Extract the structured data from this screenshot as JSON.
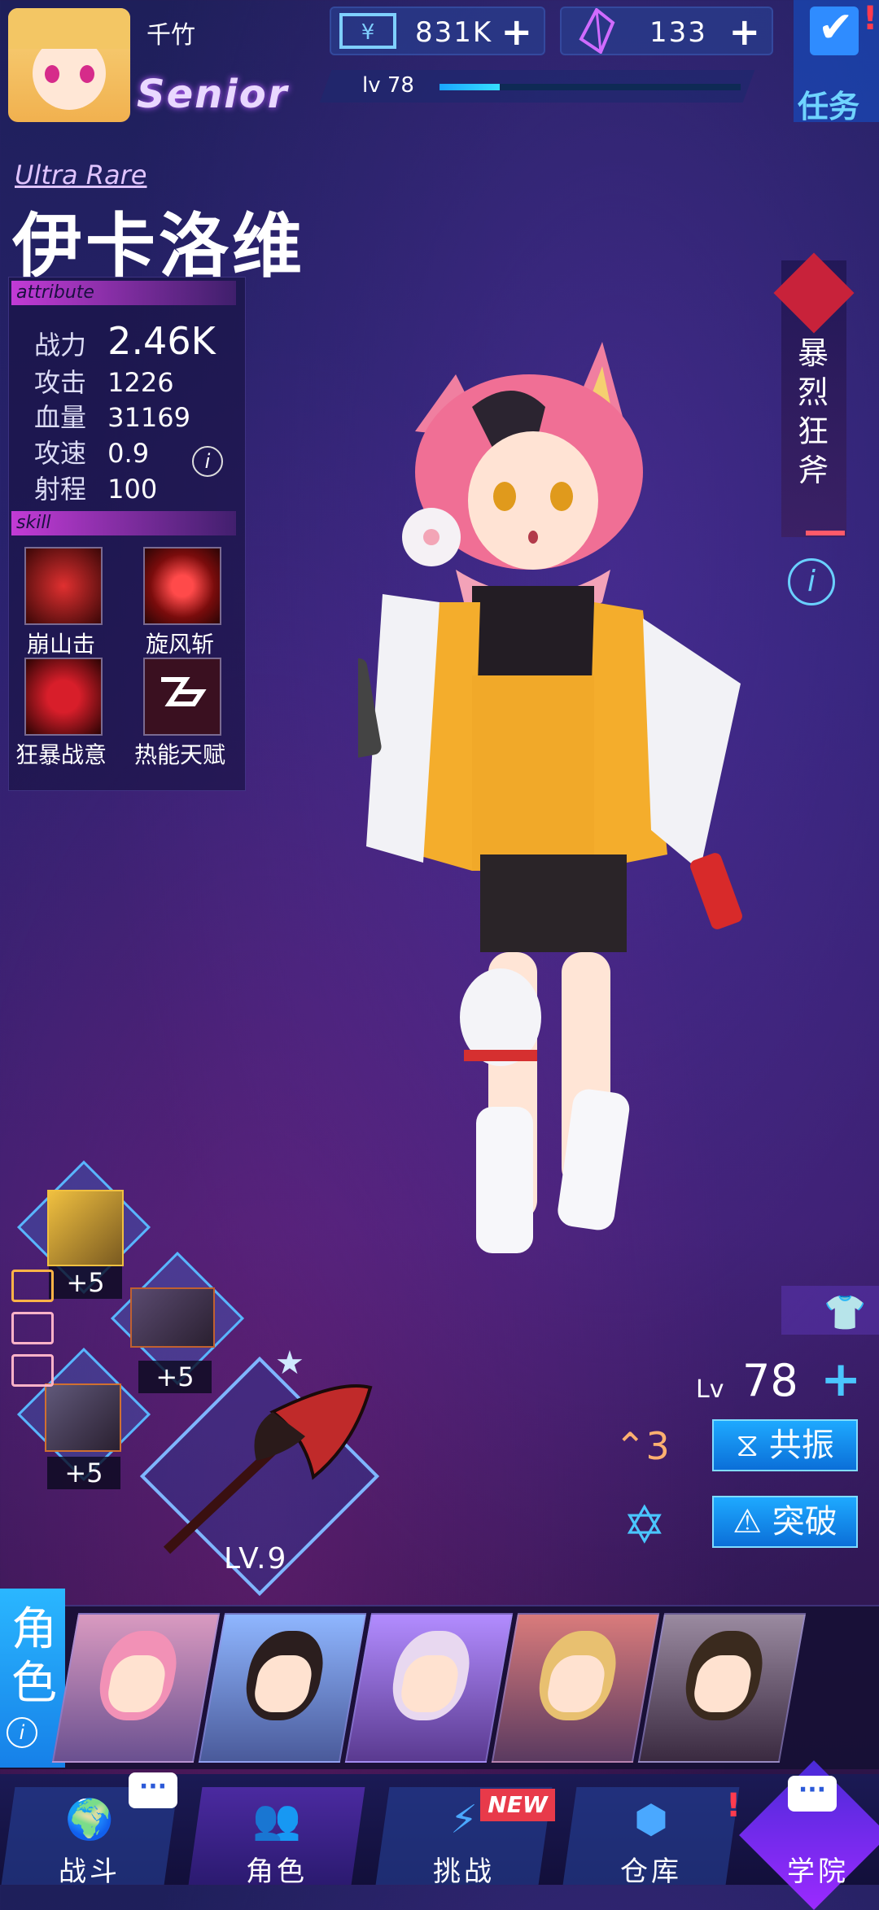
{
  "player": {
    "name": "千竹",
    "rank": "Senior",
    "level_label": "lv 78",
    "xp_fraction": 0.2
  },
  "currency": {
    "gold_value": "831K",
    "gem_value": "133"
  },
  "task": {
    "label": "任务"
  },
  "character": {
    "rarity": "Ultra Rare",
    "name": "伊卡洛维",
    "attribute_header": "attribute",
    "stats": [
      {
        "key": "战力",
        "value": "2.46K"
      },
      {
        "key": "攻击",
        "value": "1226"
      },
      {
        "key": "血量",
        "value": "31169"
      },
      {
        "key": "攻速",
        "value": "0.9"
      },
      {
        "key": "射程",
        "value": "100"
      }
    ],
    "skill_header": "skill",
    "skills": [
      "崩山击",
      "旋风斩",
      "狂暴战意",
      "热能天赋"
    ],
    "ultimate": "暴烈狂斧",
    "level_prefix": "Lv",
    "level": "78",
    "star_rank": "3",
    "resonate_label": "共振",
    "breakthrough_label": "突破"
  },
  "equipment": {
    "slots": [
      {
        "bonus": "+5"
      },
      {
        "bonus": "+5"
      },
      {
        "bonus": "+5"
      }
    ],
    "weapon_level": "LV.9"
  },
  "roster": {
    "tab_label": "角色"
  },
  "nav": {
    "items": [
      {
        "label": "战斗"
      },
      {
        "label": "角色"
      },
      {
        "label": "挑战",
        "badge": "NEW"
      },
      {
        "label": "仓库"
      },
      {
        "label": "学院"
      }
    ]
  },
  "colors": {
    "accent": "#2f9dff",
    "rarity_text": "#e0c4ff",
    "badge_red": "#e83a4a"
  }
}
